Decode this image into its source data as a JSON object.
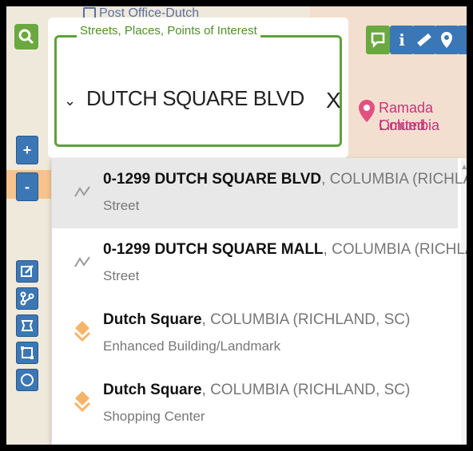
{
  "map": {
    "poi_top": "Post Office-Dutch",
    "poi_hotel_line1": "Ramada Limited",
    "poi_hotel_line2": "Columbia"
  },
  "search": {
    "legend": "Streets, Places, Points of Interest",
    "query": "DUTCH SQUARE BLVD",
    "clear_label": "X",
    "chevron": "⌄"
  },
  "zoom": {
    "in_label": "+",
    "out_label": "-"
  },
  "results": [
    {
      "name": "0-1299 DUTCH SQUARE BLVD",
      "location": ", COLUMBIA (RICHLAND, SC)",
      "type": "Street",
      "icon": "street-icon"
    },
    {
      "name": "0-1299 DUTCH SQUARE MALL",
      "location": ", COLUMBIA (RICHLAND, SC)",
      "type": "Street",
      "icon": "street-icon"
    },
    {
      "name": "Dutch Square",
      "location": ", COLUMBIA (RICHLAND, SC)",
      "type": "Enhanced Building/Landmark",
      "icon": "landmark-icon"
    },
    {
      "name": "Dutch Square",
      "location": ", COLUMBIA (RICHLAND, SC)",
      "type": "Shopping Center",
      "icon": "landmark-icon"
    }
  ],
  "colors": {
    "accent_green": "#5fa03a",
    "tool_blue": "#3c77b5",
    "poi_pink": "#c8327a"
  }
}
